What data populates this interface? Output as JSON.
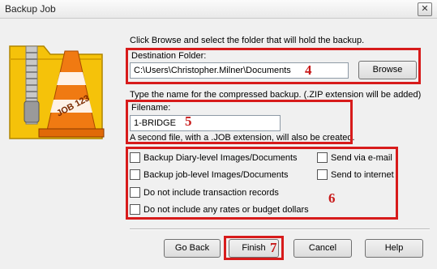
{
  "window": {
    "title": "Backup Job",
    "close_glyph": "✕"
  },
  "logo": {
    "label": "JOB 123"
  },
  "instructions": {
    "browse": "Click Browse and select the folder that will hold the backup.",
    "name": "Type the name for the compressed backup. (.ZIP extension will be added)",
    "job_note": "A second file, with a .JOB extension, will also be created."
  },
  "destination": {
    "label": "Destination Folder:",
    "value": "C:\\Users\\Christopher.Milner\\Documents",
    "browse_label": "Browse"
  },
  "filename": {
    "label": "Filename:",
    "value": "1-BRIDGE"
  },
  "options": [
    {
      "label": "Backup Diary-level Images/Documents",
      "checked": false
    },
    {
      "label": "Backup job-level Images/Documents",
      "checked": false
    },
    {
      "label": "Do not include transaction records",
      "checked": false
    },
    {
      "label": "Do not include any rates or budget dollars",
      "checked": false
    },
    {
      "label": "Send via e-mail",
      "checked": false
    },
    {
      "label": "Send to internet",
      "checked": false
    }
  ],
  "buttons": {
    "go_back": "Go Back",
    "finish": "Finish",
    "cancel": "Cancel",
    "help": "Help"
  },
  "annotations": {
    "n4": "4",
    "n5": "5",
    "n6": "6",
    "n7": "7"
  },
  "colors": {
    "annotation_red": "#d71b1b",
    "folder_yellow": "#f5c20a",
    "cone_orange": "#f07a12"
  }
}
